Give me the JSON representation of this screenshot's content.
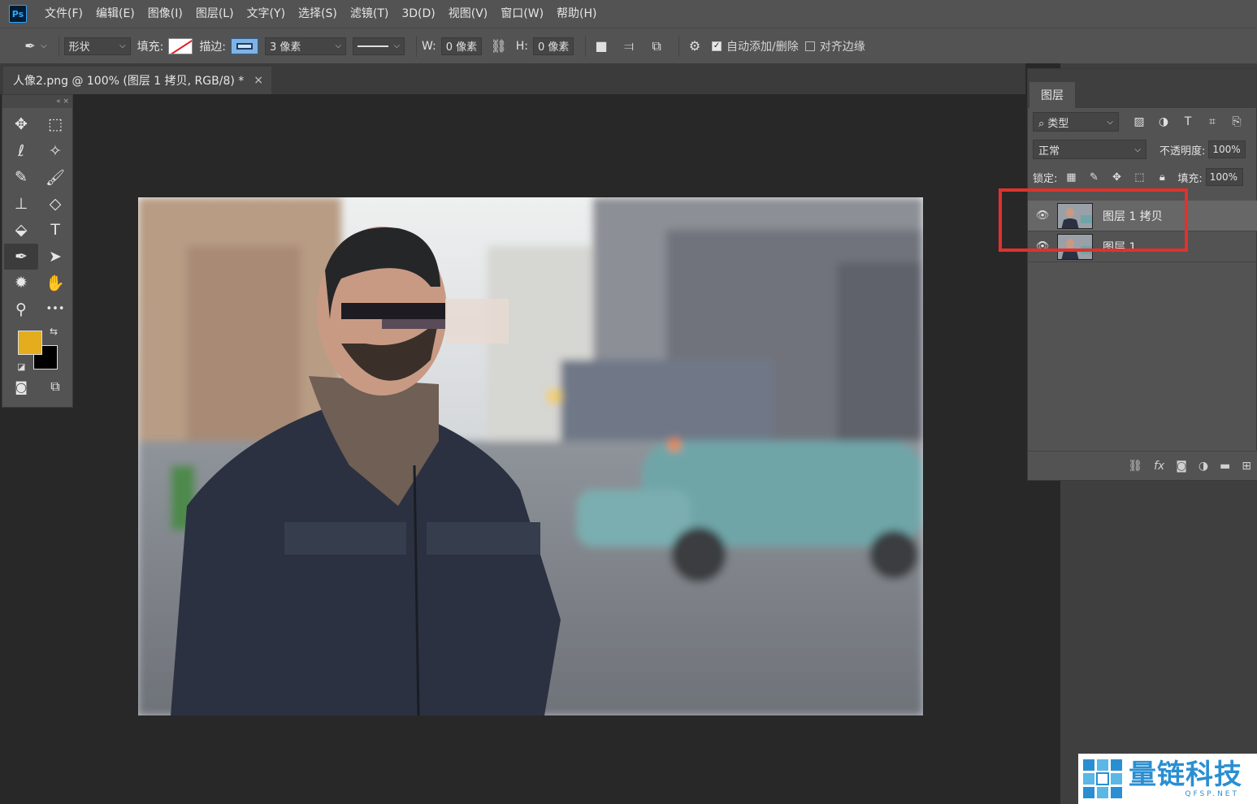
{
  "menu": {
    "logo": "Ps",
    "items": [
      "文件(F)",
      "编辑(E)",
      "图像(I)",
      "图层(L)",
      "文字(Y)",
      "选择(S)",
      "滤镜(T)",
      "3D(D)",
      "视图(V)",
      "窗口(W)",
      "帮助(H)"
    ]
  },
  "options": {
    "tool_icon": "pen-tool-icon",
    "mode": "形状",
    "fill_label": "填充:",
    "stroke_label": "描边:",
    "stroke_width": "3 像素",
    "w_label": "W:",
    "w_value": "0 像素",
    "h_label": "H:",
    "h_value": "0 像素",
    "auto_add_delete": "自动添加/删除",
    "auto_add_delete_checked": true,
    "align_edges": "对齐边缘",
    "align_edges_checked": false
  },
  "document": {
    "tab_title": "人像2.png @ 100% (图层 1 拷贝, RGB/8) *",
    "close": "×"
  },
  "tools": [
    {
      "name": "move-tool",
      "glyph": "✥"
    },
    {
      "name": "marquee-tool",
      "glyph": "⬚"
    },
    {
      "name": "lasso-tool",
      "glyph": "ℓ"
    },
    {
      "name": "magic-wand-tool",
      "glyph": "✧"
    },
    {
      "name": "eyedropper-tool",
      "glyph": "✎"
    },
    {
      "name": "brush-tool",
      "glyph": "🖌"
    },
    {
      "name": "stamp-tool",
      "glyph": "⊥"
    },
    {
      "name": "eraser-tool",
      "glyph": "◇"
    },
    {
      "name": "paint-bucket-tool",
      "glyph": "⬙"
    },
    {
      "name": "type-tool",
      "glyph": "T"
    },
    {
      "name": "pen-tool",
      "glyph": "✒"
    },
    {
      "name": "path-selection-tool",
      "glyph": "➤"
    },
    {
      "name": "custom-shape-tool",
      "glyph": "✹"
    },
    {
      "name": "hand-tool",
      "glyph": "✋"
    },
    {
      "name": "zoom-tool",
      "glyph": "⚲"
    },
    {
      "name": "more-tools",
      "glyph": "•••"
    }
  ],
  "colors": {
    "foreground": "#e3ad1e",
    "background": "#000000"
  },
  "layers_panel": {
    "tab": "图层",
    "filter_label": "类型",
    "blend_mode": "正常",
    "opacity_label": "不透明度:",
    "opacity_value": "100%",
    "lock_label": "锁定:",
    "fill_label": "填充:",
    "fill_value": "100%",
    "layers": [
      {
        "name": "图层 1 拷贝",
        "selected": true
      },
      {
        "name": "图层 1",
        "selected": false
      }
    ]
  },
  "watermark": {
    "cn": "量链科技",
    "en": "QFSP.NET"
  },
  "accent": {
    "highlight": "#e0322d"
  }
}
